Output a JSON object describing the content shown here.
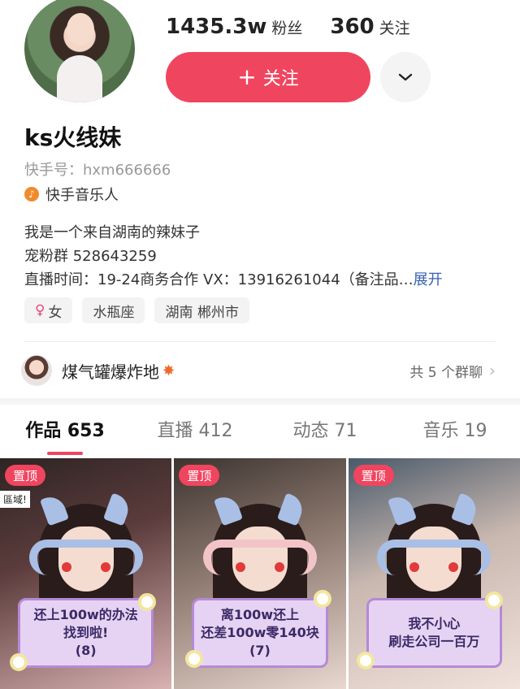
{
  "profile": {
    "followers_count": "1435.3w",
    "followers_label": "粉丝",
    "following_count": "360",
    "following_label": "关注",
    "follow_button_label": "关注",
    "name": "ks火线妹",
    "account_id": "快手号：hxm666666",
    "music_tag": "快手音乐人"
  },
  "bio": {
    "line1": "我是一个来自湖南的辣妹子",
    "line2": "宠粉群 528643259",
    "line3": "直播时间：19-24商务合作 VX：13916261044（备注品…",
    "expand": "展开"
  },
  "tags": [
    {
      "label": "女",
      "icon": "female-icon"
    },
    {
      "label": "水瓶座"
    },
    {
      "label": "湖南 郴州市"
    }
  ],
  "group_chat": {
    "name": "煤气罐爆炸地",
    "count_label": "共 5 个群聊"
  },
  "tabs": [
    {
      "label": "作品 653",
      "active": true
    },
    {
      "label": "直播 412"
    },
    {
      "label": "动态 71"
    },
    {
      "label": "音乐 19"
    }
  ],
  "videos": [
    {
      "pin_label": "置顶",
      "caption": [
        "还上100w的办法",
        "找到啦!",
        "(8)"
      ],
      "corner": "區域!"
    },
    {
      "pin_label": "置顶",
      "caption": [
        "离100w还上",
        "还差100w零140块",
        "(7)"
      ]
    },
    {
      "pin_label": "置顶",
      "caption": [
        "我不小心",
        "刷走公司一百万"
      ]
    }
  ],
  "colors": {
    "accent": "#f0455f",
    "link": "#3860b3"
  }
}
